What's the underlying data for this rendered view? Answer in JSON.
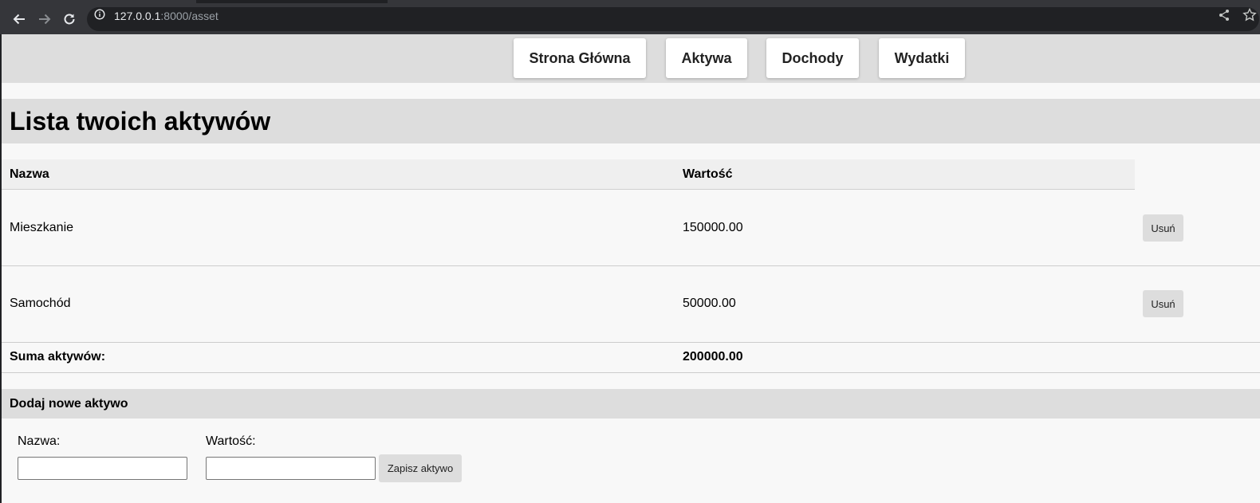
{
  "browser": {
    "url_host": "127.0.0.1",
    "url_rest": ":8000/asset",
    "icons": [
      "back-arrow-icon",
      "forward-arrow-icon",
      "reload-icon",
      "info-icon",
      "share-icon",
      "star-icon"
    ]
  },
  "nav": {
    "items": [
      {
        "label": "Strona Główna"
      },
      {
        "label": "Aktywa"
      },
      {
        "label": "Dochody"
      },
      {
        "label": "Wydatki"
      }
    ]
  },
  "page": {
    "title": "Lista twoich aktywów"
  },
  "table": {
    "headers": [
      "Nazwa",
      "Wartość"
    ],
    "rows": [
      {
        "name": "Mieszkanie",
        "value": "150000.00",
        "action": "Usuń"
      },
      {
        "name": "Samochód",
        "value": "50000.00",
        "action": "Usuń"
      }
    ],
    "total_label": "Suma aktywów:",
    "total_value": "200000.00"
  },
  "form": {
    "heading": "Dodaj nowe aktywo",
    "name_label": "Nazwa:",
    "value_label": "Wartość:",
    "name_value": "",
    "value_value": "",
    "submit_label": "Zapisz aktywo"
  },
  "colors": {
    "chrome_dark": "#202124",
    "chrome_toolbar": "#35363a",
    "band_gray": "#dddddd",
    "page_bg": "#f8f8f8"
  }
}
